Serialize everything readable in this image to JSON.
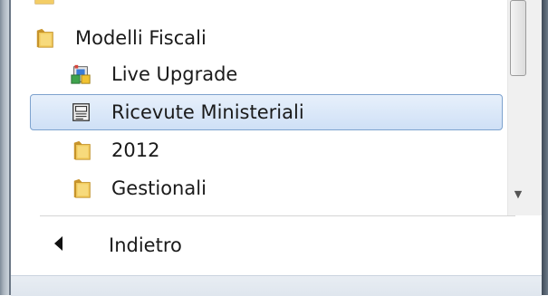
{
  "menu": {
    "items": [
      {
        "label": "",
        "icon": "folder-icon",
        "partial": true
      },
      {
        "label": "Modelli Fiscali",
        "icon": "folder-icon"
      },
      {
        "label": "Live Upgrade",
        "icon": "installer-icon"
      },
      {
        "label": "Ricevute Ministeriali",
        "icon": "document-icon",
        "selected": true
      },
      {
        "label": "2012",
        "icon": "folder-icon"
      },
      {
        "label": "Gestionali",
        "icon": "folder-icon"
      }
    ],
    "back_label": "Indietro"
  },
  "colors": {
    "selection_border": "#7da2ce",
    "selection_fill": "#dce9f9",
    "folder_yellow": "#e6b84a"
  }
}
